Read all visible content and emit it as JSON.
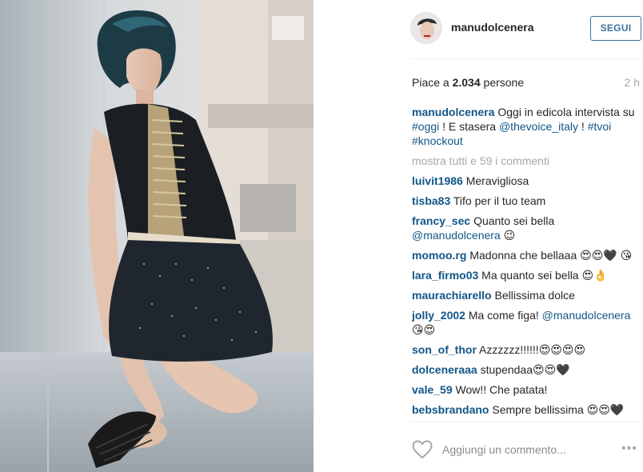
{
  "post": {
    "username": "manudolcenera",
    "follow_label": "SEGUI",
    "likes_prefix": "Piace a",
    "likes_count": "2.034",
    "likes_suffix": "persone",
    "time": "2 h",
    "caption": {
      "user": "manudolcenera",
      "text_1": "Oggi in edicola intervista su",
      "hashtag_1": "#oggi",
      "text_2": "! E stasera",
      "mention": "@thevoice_italy",
      "text_3": "!",
      "hashtag_2": "#tvoi",
      "hashtag_3": "#knockout"
    },
    "show_all_comments": "mostra tutti e 59 i commenti",
    "comments": [
      {
        "user": "luivit1986",
        "text": "Meravigliosa"
      },
      {
        "user": "tisba83",
        "text": "Tifo per il tuo team"
      },
      {
        "user": "francy_sec",
        "text": "Quanto sei bella",
        "mention": "@manudolcenera",
        "after": "😉"
      },
      {
        "user": "momoo.rg",
        "text": "Madonna che bellaaa 😍😍🖤 😘"
      },
      {
        "user": "lara_firmo03",
        "text": "Ma quanto sei bella 😍👌"
      },
      {
        "user": "maurachiarello",
        "text": "Bellissima dolce"
      },
      {
        "user": "jolly_2002",
        "text": "Ma come figa!",
        "mention": "@manudolcenera",
        "after": "😘😍"
      },
      {
        "user": "son_of_thor",
        "text": "Azzzzzz!!!!!!😍😍😍😍"
      },
      {
        "user": "dolceneraaa",
        "text": "stupendaa😍😍🖤"
      },
      {
        "user": "vale_59",
        "text": "Wow!! Che patata!"
      },
      {
        "user": "bebsbrandano",
        "text": "Sempre bellissima 😍😍🖤"
      }
    ],
    "comment_placeholder": "Aggiungi un commento...",
    "icons": {
      "like": "heart-outline-icon",
      "more": "ellipsis-icon"
    },
    "colors": {
      "link": "#125688",
      "follow": "#3f729b",
      "muted": "#a5a7aa",
      "text": "#262626"
    }
  }
}
